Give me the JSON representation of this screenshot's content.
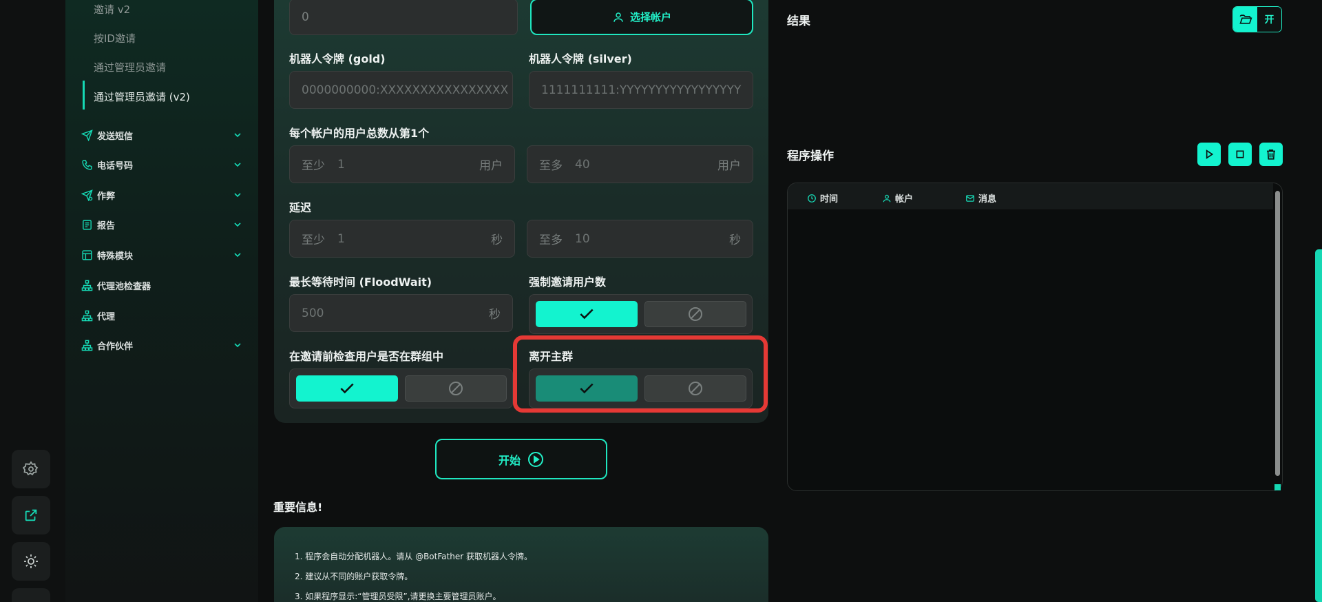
{
  "sidebar": {
    "sub_items": [
      "邀请 v2",
      "按ID邀请",
      "通过管理员邀请",
      "通过管理员邀请 (v2)"
    ],
    "nav_items": [
      {
        "label": "发送短信",
        "icon": "send-icon",
        "expandable": true
      },
      {
        "label": "电话号码",
        "icon": "phone-icon",
        "expandable": true
      },
      {
        "label": "作弊",
        "icon": "cheat-icon",
        "expandable": true
      },
      {
        "label": "报告",
        "icon": "report-icon",
        "expandable": true
      },
      {
        "label": "特殊模块",
        "icon": "module-icon",
        "expandable": true
      },
      {
        "label": "代理池检查器",
        "icon": "network-icon",
        "expandable": false
      },
      {
        "label": "代理",
        "icon": "network-icon",
        "expandable": false
      },
      {
        "label": "合作伙伴",
        "icon": "network-icon",
        "expandable": true
      }
    ]
  },
  "form": {
    "top_input_value": "0",
    "select_account_label": "选择帐户",
    "bot_token_gold": {
      "label": "机器人令牌 (gold)",
      "placeholder": "0000000000:XXXXXXXXXXXXXXXX"
    },
    "bot_token_silver": {
      "label": "机器人令牌 (silver)",
      "placeholder": "1111111111:YYYYYYYYYYYYYYYYY"
    },
    "users_total": {
      "label": "每个帐户的用户总数从第1个",
      "min_prefix": "至少",
      "min_value": "1",
      "min_unit": "用户",
      "max_prefix": "至多",
      "max_value": "40",
      "max_unit": "用户"
    },
    "delay": {
      "label": "延迟",
      "min_prefix": "至少",
      "min_value": "1",
      "min_unit": "秒",
      "max_prefix": "至多",
      "max_value": "10",
      "max_unit": "秒"
    },
    "flood_wait": {
      "label": "最长等待时间 (FloodWait)",
      "value": "500",
      "unit": "秒"
    },
    "force_invite": {
      "label": "强制邀请用户数",
      "enabled": true
    },
    "check_in_group": {
      "label": "在邀请前检查用户是否在群组中",
      "enabled": true
    },
    "leave_main_group": {
      "label": "离开主群",
      "enabled": true
    },
    "start_label": "开始"
  },
  "info": {
    "title": "重要信息!",
    "lines": [
      "1. 程序会自动分配机器人。请从 @BotFather 获取机器人令牌。",
      "2. 建议从不同的账户获取令牌。",
      "3. 如果程序显示:“管理员受限”,请更换主要管理员账户。"
    ]
  },
  "results": {
    "title": "结果",
    "toggle_label": "开"
  },
  "operations": {
    "title": "程序操作",
    "columns": [
      {
        "label": "时间",
        "icon": "clock-icon"
      },
      {
        "label": "帐户",
        "icon": "user-icon"
      },
      {
        "label": "消息",
        "icon": "mail-icon"
      }
    ]
  },
  "colors": {
    "accent": "#13f3cf",
    "highlight": "#e53935"
  }
}
